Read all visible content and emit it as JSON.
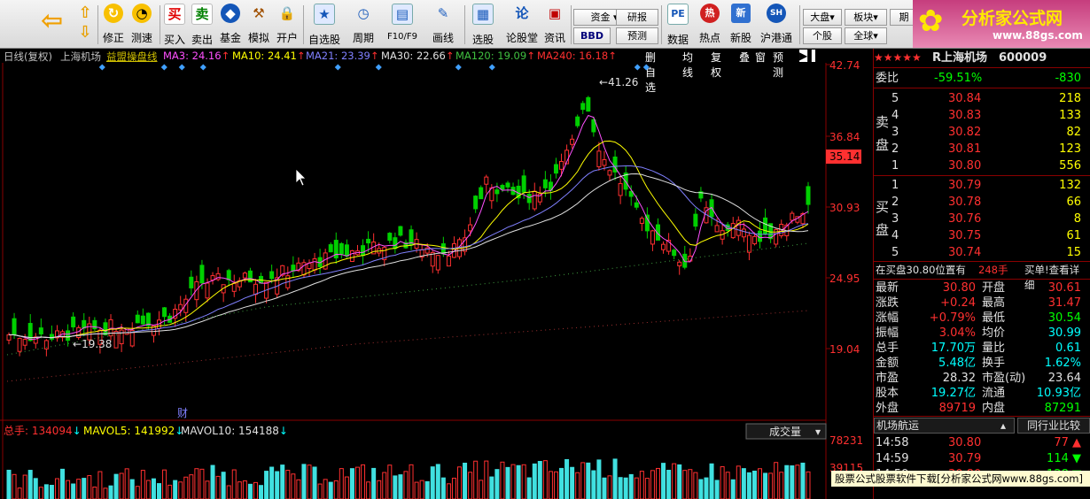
{
  "toolbar": {
    "buttons": [
      {
        "label": "修正",
        "icon": "arrow-up-down-icon"
      },
      {
        "label": "测速",
        "icon": "clock-icon"
      },
      {
        "label": "买入",
        "icon": "buy-icon"
      },
      {
        "label": "卖出",
        "icon": "sell-icon"
      },
      {
        "label": "基金",
        "icon": "fund-icon"
      },
      {
        "label": "模拟",
        "icon": "hammer-icon"
      },
      {
        "label": "开户",
        "icon": "lock-icon"
      },
      {
        "label": "自选股",
        "icon": "star-icon"
      },
      {
        "label": "周期",
        "icon": "cycle-icon"
      },
      {
        "label": "F10/F9",
        "icon": "f10-icon"
      },
      {
        "label": "画线",
        "icon": "pen-icon"
      },
      {
        "label": "选股",
        "icon": "select-stock-icon"
      },
      {
        "label": "论股堂",
        "icon": "forum-icon"
      },
      {
        "label": "资讯",
        "icon": "news-icon"
      },
      {
        "label": "数据",
        "icon": "pe-icon"
      },
      {
        "label": "热点",
        "icon": "hot-icon"
      },
      {
        "label": "新股",
        "icon": "new-stock-icon"
      },
      {
        "label": "沪港通",
        "icon": "hk-connect-icon"
      }
    ],
    "small": {
      "zijin": "资金",
      "yanbao": "研报",
      "bbd": "BBD",
      "yuce": "预测",
      "dapan": "大盘",
      "bankuai": "板块",
      "gegu": "个股",
      "quanqiu": "全球",
      "qi": "期"
    }
  },
  "logo": {
    "title": "分析家公式网",
    "url": "www.88gs.com"
  },
  "chart_header": {
    "title": "日线(复权)",
    "name": "上海机场",
    "indicator": "益盟操盘线",
    "ma3": "MA3: 24.16",
    "ma10": "MA10: 24.41",
    "ma21": "MA21: 23.39",
    "ma30": "MA30: 22.66",
    "ma120": "MA120: 19.09",
    "ma240": "MA240: 16.18",
    "modes": [
      "删自选",
      "均线",
      "复权",
      "叠",
      "窗",
      "预测"
    ]
  },
  "price_axis": [
    "42.74",
    "36.84",
    "35.14",
    "30.93",
    "24.95",
    "19.04"
  ],
  "annotations": {
    "high": "41.26",
    "low": "19.38",
    "cai": "财"
  },
  "volume_header": {
    "vol": "总手: 134094",
    "mavol5": "MAVOL5: 141992",
    "mavol10": "MAVOL10: 154188",
    "selector": "成交量",
    "axis_top": "78231",
    "axis_mid": "39115"
  },
  "quote": {
    "stars": "★★★★★",
    "name": "R上海机场",
    "code": "600009",
    "weibi_label": "委比",
    "weibi": "-59.51%",
    "weicha": "-830",
    "sell_label": "卖盘",
    "buy_label": "买盘",
    "sells": [
      {
        "lvl": "5",
        "price": "30.84",
        "vol": "218"
      },
      {
        "lvl": "4",
        "price": "30.83",
        "vol": "133"
      },
      {
        "lvl": "3",
        "price": "30.82",
        "vol": "82"
      },
      {
        "lvl": "2",
        "price": "30.81",
        "vol": "123"
      },
      {
        "lvl": "1",
        "price": "30.80",
        "vol": "556"
      }
    ],
    "buys": [
      {
        "lvl": "1",
        "price": "30.79",
        "vol": "132"
      },
      {
        "lvl": "2",
        "price": "30.78",
        "vol": "66"
      },
      {
        "lvl": "3",
        "price": "30.76",
        "vol": "8"
      },
      {
        "lvl": "4",
        "price": "30.75",
        "vol": "61"
      },
      {
        "lvl": "5",
        "price": "30.74",
        "vol": "15"
      }
    ],
    "info_left": "在买盘30.80位置有",
    "info_mid": "248手",
    "info_right": "买单!查看详细",
    "stats": [
      {
        "l": "最新",
        "v": "30.80",
        "l2": "开盘",
        "v2": "30.61"
      },
      {
        "l": "涨跌",
        "v": "+0.24",
        "l2": "最高",
        "v2": "31.47"
      },
      {
        "l": "涨幅",
        "v": "+0.79%",
        "l2": "最低",
        "v2": "30.54"
      },
      {
        "l": "振幅",
        "v": "3.04%",
        "l2": "均价",
        "v2": "30.99"
      },
      {
        "l": "总手",
        "v": "17.70万",
        "l2": "量比",
        "v2": "0.61"
      },
      {
        "l": "金额",
        "v": "5.48亿",
        "l2": "换手",
        "v2": "1.62%"
      },
      {
        "l": "市盈",
        "v": "28.32",
        "l2": "市盈(动)",
        "v2": "23.64"
      },
      {
        "l": "股本",
        "v": "19.27亿",
        "l2": "流通",
        "v2": "10.93亿"
      },
      {
        "l": "外盘",
        "v": "89719",
        "l2": "内盘",
        "v2": "87291"
      }
    ],
    "tab1": "机场航运",
    "tab2": "同行业比较",
    "ticks": [
      {
        "t": "14:58",
        "p": "30.80",
        "v": "77"
      },
      {
        "t": "14:59",
        "p": "30.79",
        "v": "114"
      },
      {
        "t": "14:59",
        "p": "30.80",
        "v": "128"
      }
    ]
  },
  "watermark": "股票公式股票软件下载[分析家公式网www.88gs.com]"
}
